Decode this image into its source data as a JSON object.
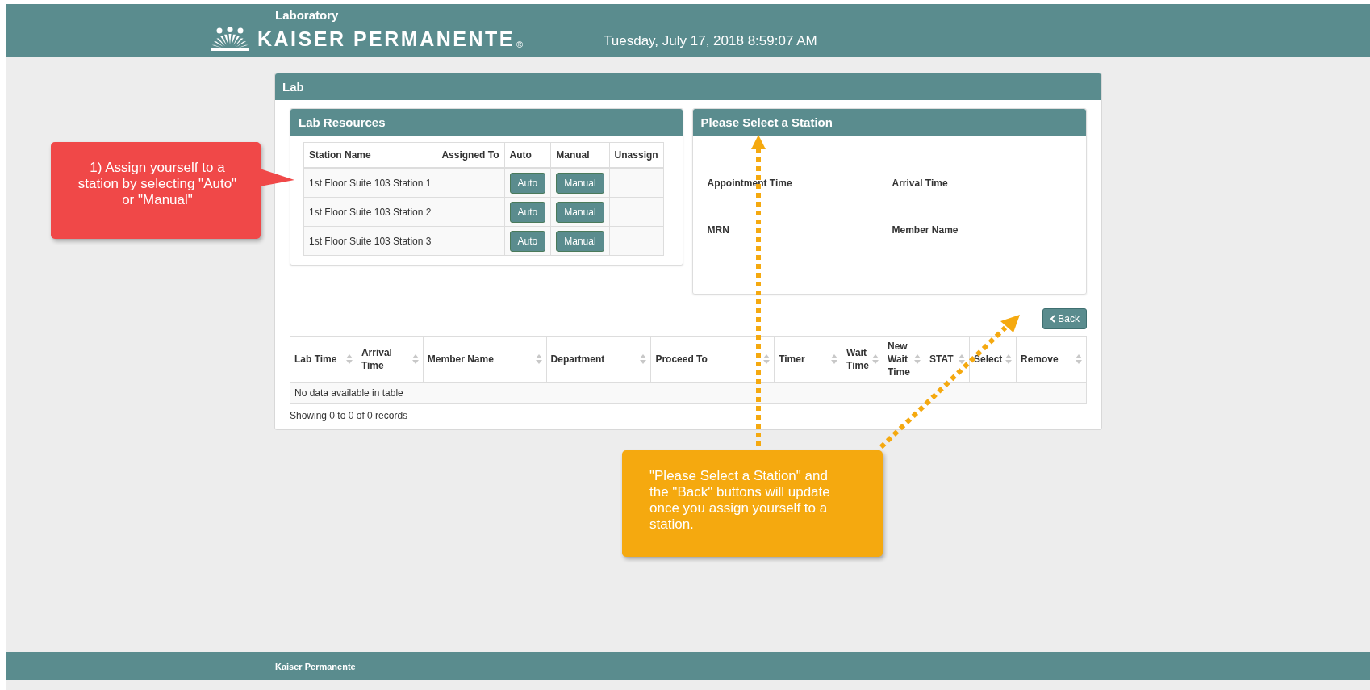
{
  "header": {
    "app_label": "Laboratory",
    "brand": "KAISER PERMANENTE",
    "registered_mark": "®",
    "datetime": "Tuesday, July 17, 2018 8:59:07 AM"
  },
  "lab_panel": {
    "title": "Lab",
    "resources": {
      "title": "Lab Resources",
      "columns": [
        "Station Name",
        "Assigned To",
        "Auto",
        "Manual",
        "Unassign"
      ],
      "rows": [
        {
          "station": "1st Floor Suite 103 Station 1",
          "auto": "Auto",
          "manual": "Manual"
        },
        {
          "station": "1st Floor Suite 103 Station 2",
          "auto": "Auto",
          "manual": "Manual"
        },
        {
          "station": "1st Floor Suite 103 Station 3",
          "auto": "Auto",
          "manual": "Manual"
        }
      ]
    },
    "station": {
      "title": "Please Select a Station",
      "fields": [
        "Appointment Time",
        "Arrival Time",
        "MRN",
        "Member Name"
      ]
    },
    "back_button": "Back",
    "table": {
      "columns": [
        {
          "label": "Lab Time"
        },
        {
          "label": "Arrival Time"
        },
        {
          "label": "Member Name"
        },
        {
          "label": "Department"
        },
        {
          "label": "Proceed To"
        },
        {
          "label": "Timer"
        },
        {
          "label": "Wait Time"
        },
        {
          "label": "New Wait Time"
        },
        {
          "label": "STAT"
        },
        {
          "label": "Select"
        },
        {
          "label": "Remove"
        }
      ],
      "empty_message": "No data available in table",
      "info": "Showing 0 to 0 of 0 records"
    }
  },
  "footer": {
    "text": "Kaiser Permanente"
  },
  "callouts": [
    {
      "kind": "left",
      "color": "#f04848",
      "text": "1) Assign yourself to a station by selecting \"Auto\" or \"Manual\""
    },
    {
      "kind": "below",
      "color": "#f5a90f",
      "text": "\"Please Select a Station\" and the \"Back\" buttons will update once you assign yourself to a station."
    }
  ]
}
